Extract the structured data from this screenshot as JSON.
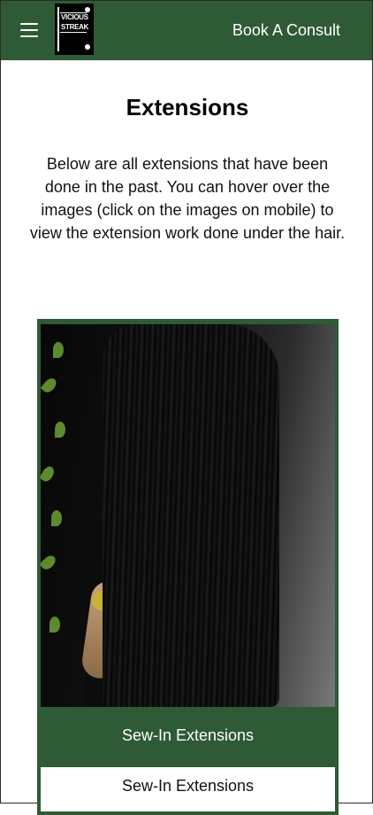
{
  "header": {
    "menu_icon": "hamburger-icon",
    "logo_text_line1": "VICIOUS",
    "logo_text_line2": "STREAK",
    "cta_label": "Book A Consult",
    "background_color": "#2f5a36"
  },
  "main": {
    "title": "Extensions",
    "intro": "Below are all extensions that have been done in the past. You can hover over the images (click on the images on mobile) to view the extension work done under the hair."
  },
  "gallery": {
    "cards": [
      {
        "title": "Sew-In Extensions",
        "subtitle": "Sew-In Extensions"
      }
    ]
  }
}
